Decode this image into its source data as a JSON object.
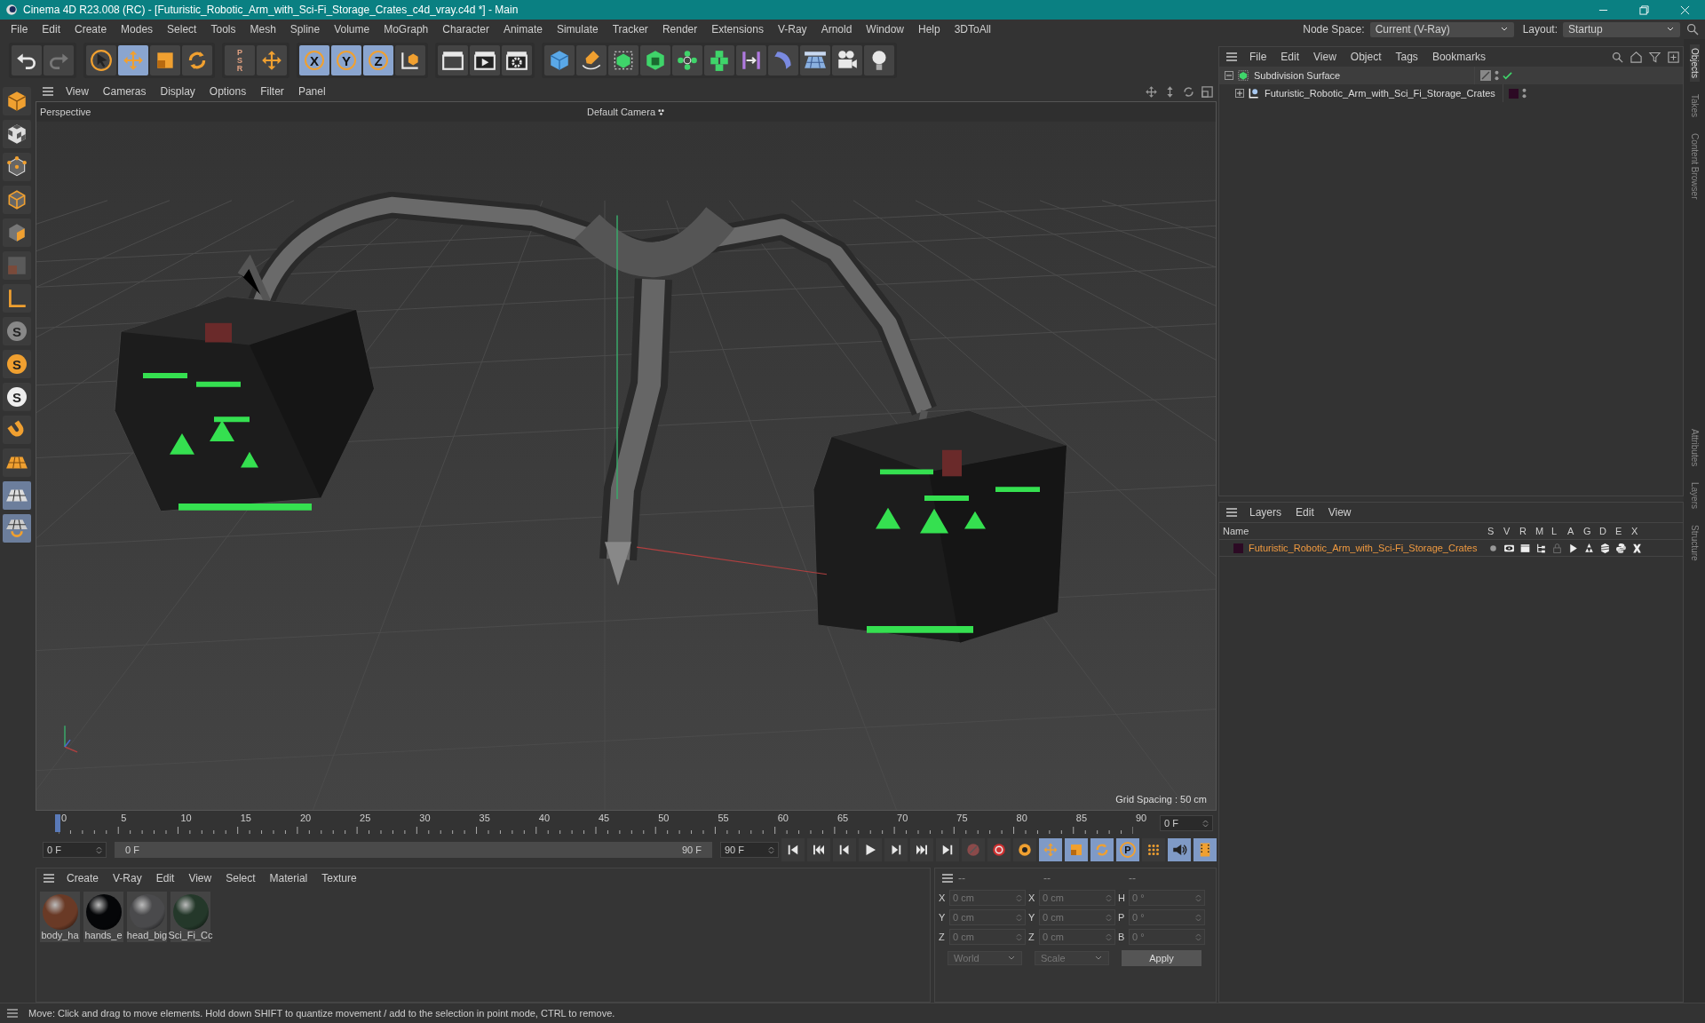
{
  "window": {
    "title": "Cinema 4D R23.008 (RC) - [Futuristic_Robotic_Arm_with_Sci-Fi_Storage_Crates_c4d_vray.c4d *] - Main"
  },
  "menu": [
    "File",
    "Edit",
    "Create",
    "Modes",
    "Select",
    "Tools",
    "Mesh",
    "Spline",
    "Volume",
    "MoGraph",
    "Character",
    "Animate",
    "Simulate",
    "Tracker",
    "Render",
    "Extensions",
    "V-Ray",
    "Arnold",
    "Window",
    "Help",
    "3DToAll"
  ],
  "node_space": {
    "label": "Node Space:",
    "value": "Current (V-Ray)"
  },
  "layout": {
    "label": "Layout:",
    "value": "Startup"
  },
  "toolbar": {
    "groups": [
      [
        {
          "kind": "undo",
          "selected": false
        },
        {
          "kind": "redo",
          "selected": false
        }
      ],
      [
        {
          "kind": "select",
          "selected": false
        },
        {
          "kind": "move",
          "selected": true
        },
        {
          "kind": "scale",
          "selected": false
        },
        {
          "kind": "rotate",
          "selected": false
        }
      ],
      [
        {
          "kind": "psr",
          "label": "PSR",
          "selected": false
        },
        {
          "kind": "add",
          "selected": false
        }
      ],
      [
        {
          "kind": "axis",
          "label": "X",
          "selected": true
        },
        {
          "kind": "axis",
          "label": "Y",
          "selected": true
        },
        {
          "kind": "axis",
          "label": "Z",
          "selected": true
        },
        {
          "kind": "coord",
          "selected": false
        }
      ],
      [
        {
          "kind": "render-view",
          "selected": false
        },
        {
          "kind": "render",
          "selected": false
        },
        {
          "kind": "render-settings",
          "selected": false
        }
      ],
      [
        {
          "kind": "cube",
          "selected": false
        },
        {
          "kind": "pen",
          "selected": false
        },
        {
          "kind": "subdiv",
          "selected": false
        },
        {
          "kind": "extrude",
          "selected": false
        },
        {
          "kind": "array",
          "selected": false
        },
        {
          "kind": "cloner",
          "selected": false
        },
        {
          "kind": "symmetry",
          "selected": false
        },
        {
          "kind": "deformer",
          "selected": false
        },
        {
          "kind": "floor",
          "selected": false
        },
        {
          "kind": "camera",
          "selected": false
        },
        {
          "kind": "light",
          "selected": false
        }
      ]
    ]
  },
  "left_tools": [
    {
      "kind": "model",
      "selected": false
    },
    {
      "kind": "texture",
      "selected": false
    },
    {
      "kind": "points",
      "selected": false
    },
    {
      "kind": "edges",
      "selected": false
    },
    {
      "kind": "polygons",
      "selected": false
    },
    {
      "kind": "uv",
      "selected": false
    },
    {
      "kind": "axis-l",
      "selected": false
    },
    {
      "kind": "snap",
      "label": "S",
      "selected": false
    },
    {
      "kind": "snap-on",
      "label": "S",
      "selected": false
    },
    {
      "kind": "snap-solid",
      "label": "S",
      "selected": false
    },
    {
      "kind": "magnet",
      "selected": false
    },
    {
      "kind": "workplane",
      "selected": false
    },
    {
      "kind": "grid",
      "selected": true
    },
    {
      "kind": "grid-snap",
      "selected": true
    }
  ],
  "viewport": {
    "menu": [
      "View",
      "Cameras",
      "Display",
      "Options",
      "Filter",
      "Panel"
    ],
    "name": "Perspective",
    "camera": "Default Camera",
    "grid_spacing": "Grid Spacing : 50 cm"
  },
  "timeline": {
    "ticks": [
      "0",
      "5",
      "10",
      "15",
      "20",
      "25",
      "30",
      "35",
      "40",
      "45",
      "50",
      "55",
      "60",
      "65",
      "70",
      "75",
      "80",
      "85",
      "90"
    ],
    "playhead": {
      "level": 0
    },
    "current": "0 F",
    "start": "0 F",
    "range": {
      "start": "0 F",
      "end": "90 F",
      "level": 1
    },
    "end": "90 F",
    "controls": [
      {
        "kind": "go-start",
        "selected": false
      },
      {
        "kind": "prev-key",
        "selected": false
      },
      {
        "kind": "prev-frame",
        "selected": false
      },
      {
        "kind": "play",
        "selected": false
      },
      {
        "kind": "next-frame",
        "selected": false
      },
      {
        "kind": "next-key",
        "selected": false
      },
      {
        "kind": "go-end",
        "selected": false
      },
      {
        "kind": "record",
        "selected": false
      },
      {
        "kind": "autokey",
        "selected": false
      },
      {
        "kind": "keyframe",
        "selected": false
      },
      {
        "kind": "move",
        "selected": true
      },
      {
        "kind": "scale",
        "selected": true
      },
      {
        "kind": "rotate",
        "selected": true
      },
      {
        "kind": "param",
        "label": "P",
        "selected": true
      },
      {
        "kind": "dots",
        "selected": false
      },
      {
        "kind": "sound",
        "selected": true
      },
      {
        "kind": "film",
        "selected": true
      }
    ]
  },
  "materials": {
    "menu": [
      "Create",
      "V-Ray",
      "Edit",
      "View",
      "Select",
      "Material",
      "Texture"
    ],
    "items": [
      {
        "name": "body_ha",
        "color": "#6a3a26"
      },
      {
        "name": "hands_e",
        "color": "#050608"
      },
      {
        "name": "head_big",
        "color": "#4a4a4c"
      },
      {
        "name": "Sci_Fi_Cc",
        "color": "#24382a"
      }
    ]
  },
  "coordinates": {
    "headers": [
      "--",
      "--",
      "--"
    ],
    "rows": [
      [
        {
          "label": "X",
          "value": "0 cm"
        },
        {
          "label": "X",
          "value": "0 cm"
        },
        {
          "label": "H",
          "value": "0 °"
        }
      ],
      [
        {
          "label": "Y",
          "value": "0 cm"
        },
        {
          "label": "Y",
          "value": "0 cm"
        },
        {
          "label": "P",
          "value": "0 °"
        }
      ],
      [
        {
          "label": "Z",
          "value": "0 cm"
        },
        {
          "label": "Z",
          "value": "0 cm"
        },
        {
          "label": "B",
          "value": "0 °"
        }
      ]
    ],
    "mode": "World",
    "size_mode": "Scale",
    "apply": "Apply",
    "disabled": true
  },
  "objects": {
    "menu": [
      "File",
      "Edit",
      "View",
      "Object",
      "Tags",
      "Bookmarks"
    ],
    "tree": [
      {
        "name": "Subdivision Surface",
        "kind": "subdiv",
        "expanded": true,
        "checked": true,
        "children": [
          {
            "name": "Futuristic_Robotic_Arm_with_Sci_Fi_Storage_Crates",
            "kind": "null",
            "expanded": false,
            "checked": false,
            "color": "#2c0a24"
          }
        ]
      }
    ]
  },
  "layers": {
    "menu": [
      "Layers",
      "Edit",
      "View"
    ],
    "columns": [
      "Name",
      "S",
      "V",
      "R",
      "M",
      "L",
      "A",
      "G",
      "D",
      "E",
      "X"
    ],
    "rows": [
      {
        "name": "Futuristic_Robotic_Arm_with_Sci-Fi_Storage_Crates",
        "color": "#2c0a24"
      }
    ]
  },
  "side_tabs": [
    {
      "label": "Objects",
      "selected": true
    },
    {
      "label": "Takes",
      "selected": false
    },
    {
      "label": "Content Browser",
      "selected": false
    },
    {
      "label": "Attributes",
      "selected": false
    },
    {
      "label": "Layers",
      "selected": false
    },
    {
      "label": "Structure",
      "selected": false
    }
  ],
  "status_bar": "Move: Click and drag to move elements. Hold down SHIFT to quantize movement / add to the selection in point mode, CTRL to remove."
}
